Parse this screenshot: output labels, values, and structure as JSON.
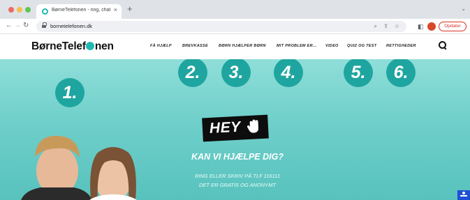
{
  "browser": {
    "tab_title": "BørneTelefonen - ring, chat, s...",
    "tab_close": "×",
    "new_tab": "+",
    "url": "bornetelefonen.dk",
    "update_label": "Opdater"
  },
  "site": {
    "logo_prefix": "BørneTelef",
    "logo_suffix": "nen",
    "nav": [
      {
        "label": "FÅ HJÆLP"
      },
      {
        "label": "BREVKASSE"
      },
      {
        "label": "BØRN HJÆLPER BØRN"
      },
      {
        "label": "MIT PROBLEM ER..."
      },
      {
        "label": "VIDEO"
      },
      {
        "label": "QUIZ OG TEST"
      },
      {
        "label": "RETTIGHEDER"
      }
    ]
  },
  "badges": [
    "1.",
    "2.",
    "3.",
    "4.",
    "5.",
    "6."
  ],
  "hero": {
    "hey": "HEY",
    "title": "KAN VI HJÆLPE DIG?",
    "subtitle_line1": "RING ELLER SKRIV PÅ TLF 116111",
    "subtitle_line2": "DET ER GRATIS OG ANONYMT"
  },
  "colors": {
    "brand_teal": "#23b7b1",
    "badge_teal": "#1fa59f",
    "hero_bg": "#6fcfca",
    "update_red": "#d93025"
  },
  "icons": [
    "back-arrow-icon",
    "forward-arrow-icon",
    "reload-icon",
    "lock-icon",
    "zoom-icon",
    "share-icon",
    "star-icon",
    "split-view-icon",
    "search-icon",
    "waving-hand-icon",
    "accessibility-icon"
  ]
}
